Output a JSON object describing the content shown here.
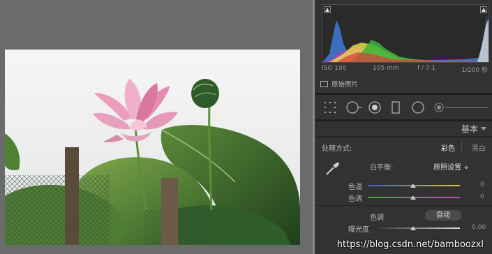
{
  "histogram": {
    "iso": "ISO 100",
    "focal": "105 mm",
    "aperture": "f / 7.1",
    "shutter": "1/200 秒"
  },
  "original_photo_label": "原始照片",
  "panel_title": "基本",
  "treatment": {
    "label": "处理方式:",
    "color": "彩色",
    "bw": "黑白"
  },
  "white_balance": {
    "label": "白平衡:",
    "value": "原照设置 ÷"
  },
  "temp": {
    "label": "色温",
    "value": "0"
  },
  "tint": {
    "label": "色调",
    "value": "0"
  },
  "tone": {
    "label": "色调",
    "auto": "自动"
  },
  "exposure": {
    "label": "曝光度",
    "value": "0.00"
  },
  "watermark": "https://blog.csdn.net/bamboozxl"
}
